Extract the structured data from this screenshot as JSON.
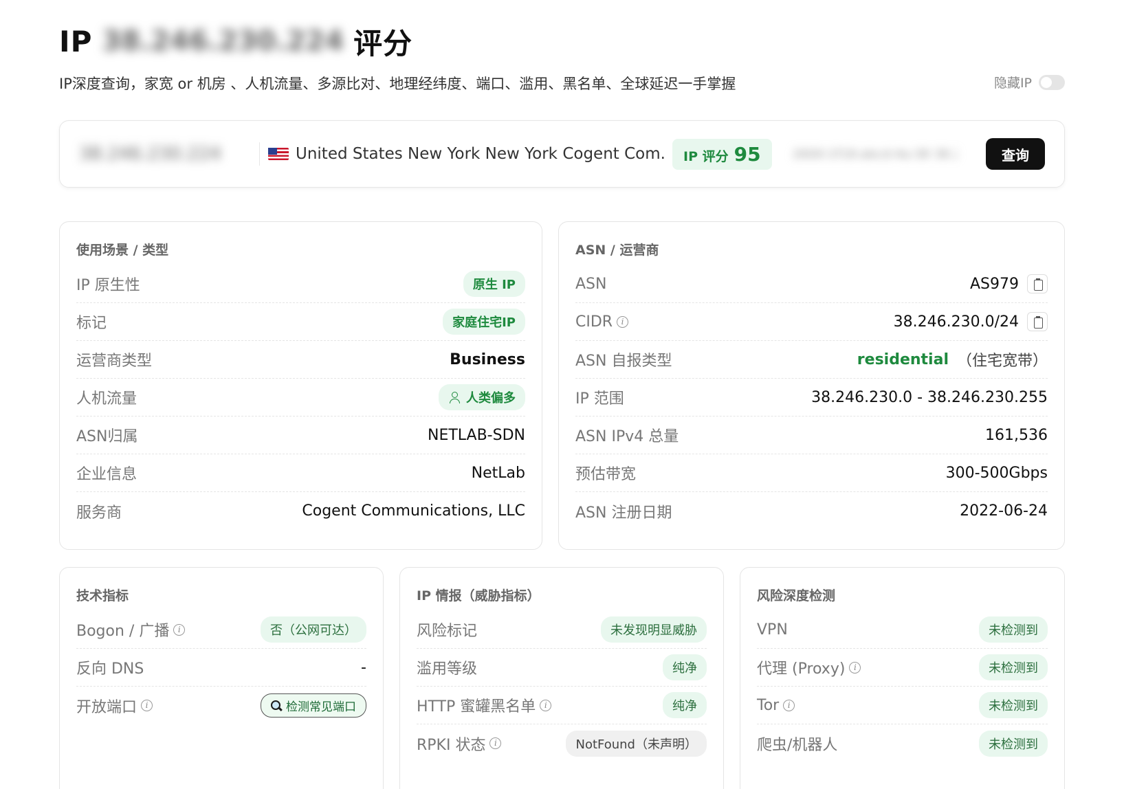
{
  "header": {
    "title_prefix": "IP",
    "title_ip": "38.246.230.224",
    "title_suffix": "评分",
    "subtitle": "IP深度查询，家宽 or 机房 、人机流量、多源比对、地理经纬度、端口、滥用、黑名单、全球延迟一手掌握",
    "hide_ip_label": "隐藏IP",
    "hide_ip_on": false
  },
  "search": {
    "ip": "38.246.230.224",
    "location": "United States New York New York Cogent Com...",
    "score_label": "IP 评分",
    "score": "95",
    "blurred_text": "2600:1f18:abcd:4a:38 38.246.230.224",
    "query_button": "查询"
  },
  "usage": {
    "title": "使用场景 / 类型",
    "rows": [
      {
        "key": "IP 原生性",
        "value": "原生 IP"
      },
      {
        "key": "标记",
        "value": "家庭住宅IP"
      },
      {
        "key": "运营商类型",
        "value": "Business"
      },
      {
        "key": "人机流量",
        "value": "人类偏多"
      },
      {
        "key": "ASN归属",
        "value": "NETLAB-SDN"
      },
      {
        "key": "企业信息",
        "value": "NetLab"
      },
      {
        "key": "服务商",
        "value": "Cogent Communications, LLC"
      }
    ]
  },
  "asn": {
    "title": "ASN / 运营商",
    "rows": [
      {
        "key": "ASN",
        "value": "AS979"
      },
      {
        "key": "CIDR",
        "value": "38.246.230.0/24"
      },
      {
        "key": "ASN 自报类型",
        "value": "residential",
        "note": "（住宅宽带）"
      },
      {
        "key": "IP 范围",
        "value": "38.246.230.0 - 38.246.230.255"
      },
      {
        "key": "ASN IPv4 总量",
        "value": "161,536"
      },
      {
        "key": "预估带宽",
        "value": "300-500Gbps"
      },
      {
        "key": "ASN 注册日期",
        "value": "2022-06-24"
      }
    ]
  },
  "tech": {
    "title": "技术指标",
    "rows": [
      {
        "key": "Bogon / 广播",
        "value": "否（公网可达）"
      },
      {
        "key": "反向 DNS",
        "value": "-"
      },
      {
        "key": "开放端口",
        "value": "检测常见端口"
      }
    ]
  },
  "intel": {
    "title": "IP 情报（威胁指标）",
    "rows": [
      {
        "key": "风险标记",
        "value": "未发现明显威胁"
      },
      {
        "key": "滥用等级",
        "value": "纯净"
      },
      {
        "key": "HTTP 蜜罐黑名单",
        "value": "纯净"
      },
      {
        "key": "RPKI 状态",
        "value": "NotFound（未声明）"
      }
    ]
  },
  "risk": {
    "title": "风险深度检测",
    "rows": [
      {
        "key": "VPN",
        "value": "未检测到"
      },
      {
        "key": "代理 (Proxy)",
        "value": "未检测到"
      },
      {
        "key": "Tor",
        "value": "未检测到"
      },
      {
        "key": "爬虫/机器人",
        "value": "未检测到"
      }
    ]
  },
  "colors": {
    "accent_green": "#1e8a3e",
    "pill_green_bg": "#e8f7ee",
    "button_dark": "#111111"
  }
}
